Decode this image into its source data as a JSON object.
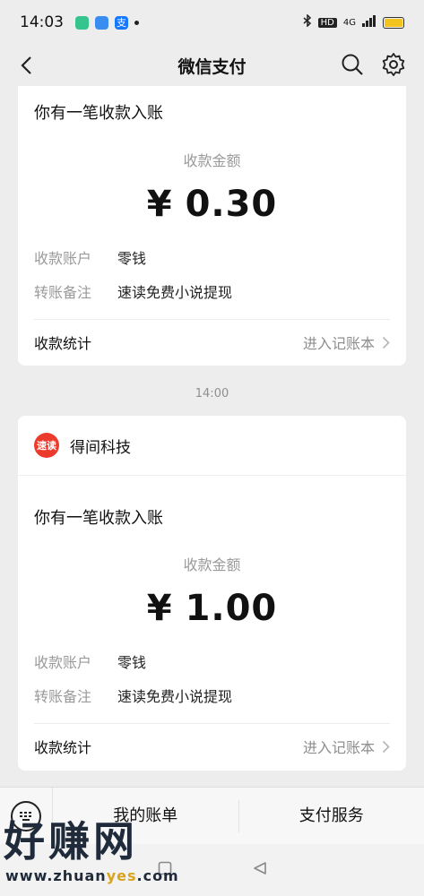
{
  "status_bar": {
    "time": "14:03",
    "network": "4G",
    "hd": "HD"
  },
  "nav": {
    "title": "微信支付"
  },
  "messages": [
    {
      "notice_title": "你有一笔收款入账",
      "amount_label": "收款金额",
      "currency": "¥",
      "amount": "0.30",
      "account_label": "收款账户",
      "account_value": "零钱",
      "remark_label": "转账备注",
      "remark_value": "速读免费小说提现",
      "stats_label": "收款统计",
      "stats_link": "进入记账本"
    },
    {
      "sender_logo_text": "速读",
      "sender_name": "得间科技",
      "notice_title": "你有一笔收款入账",
      "amount_label": "收款金额",
      "currency": "¥",
      "amount": "1.00",
      "account_label": "收款账户",
      "account_value": "零钱",
      "remark_label": "转账备注",
      "remark_value": "速读免费小说提现",
      "stats_label": "收款统计",
      "stats_link": "进入记账本"
    }
  ],
  "timestamp": "14:00",
  "bottom_menu": {
    "bills": "我的账单",
    "services": "支付服务"
  },
  "watermark": {
    "text": "好赚网",
    "url_prefix": "www.zhuan",
    "url_highlight": "yes",
    "url_suffix": ".com"
  },
  "colors": {
    "background": "#ededed",
    "card": "#ffffff",
    "muted_text": "#9a9a9a",
    "sender_logo": "#ec3b2c"
  },
  "icons": [
    "back-arrow-icon",
    "search-icon",
    "gear-icon",
    "chevron-right-icon",
    "keyboard-icon",
    "home-square-icon",
    "back-triangle-icon"
  ]
}
